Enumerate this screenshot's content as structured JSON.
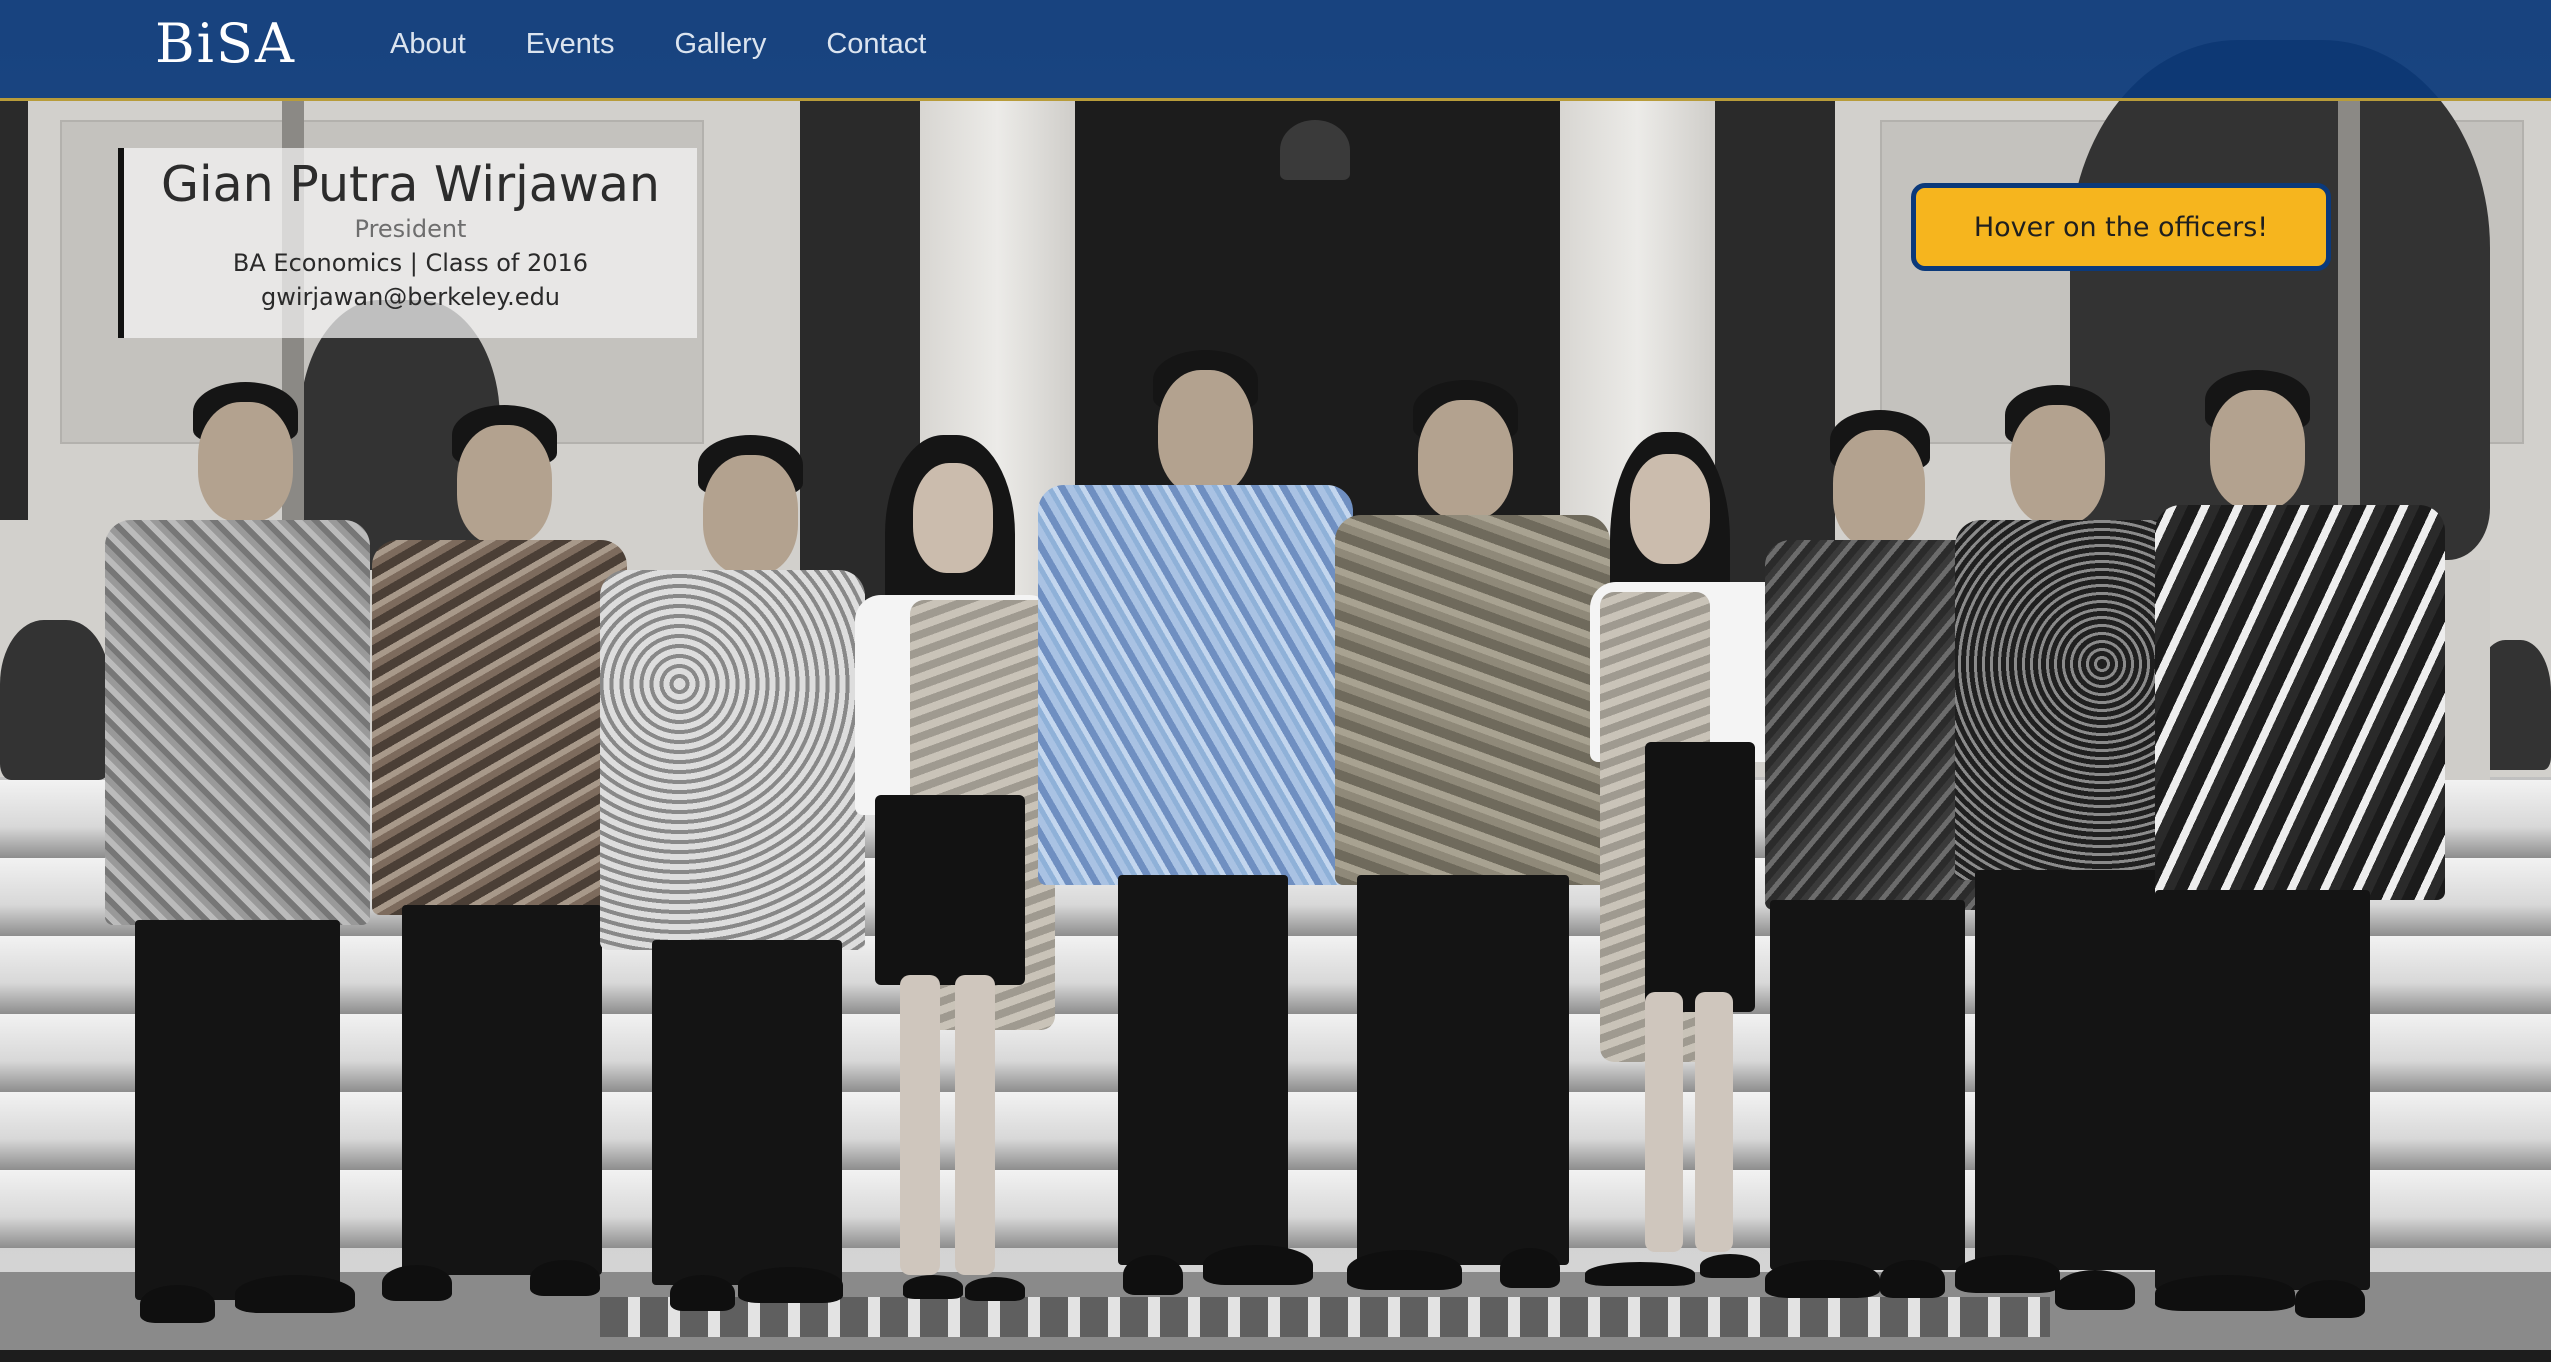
{
  "brand": {
    "logo_text": "BiSA"
  },
  "nav": {
    "items": [
      {
        "label": "About"
      },
      {
        "label": "Events"
      },
      {
        "label": "Gallery"
      },
      {
        "label": "Contact"
      }
    ]
  },
  "officer_card": {
    "name": "Gian Putra Wirjawan",
    "role": "President",
    "degree": "BA Economics | Class of 2016",
    "email": "gwirjawan@berkeley.edu"
  },
  "cta": {
    "label": "Hover on the officers!"
  },
  "colors": {
    "navbar": "#0b397a",
    "accent": "#f6b51e",
    "gold_border": "#b89c3a"
  }
}
